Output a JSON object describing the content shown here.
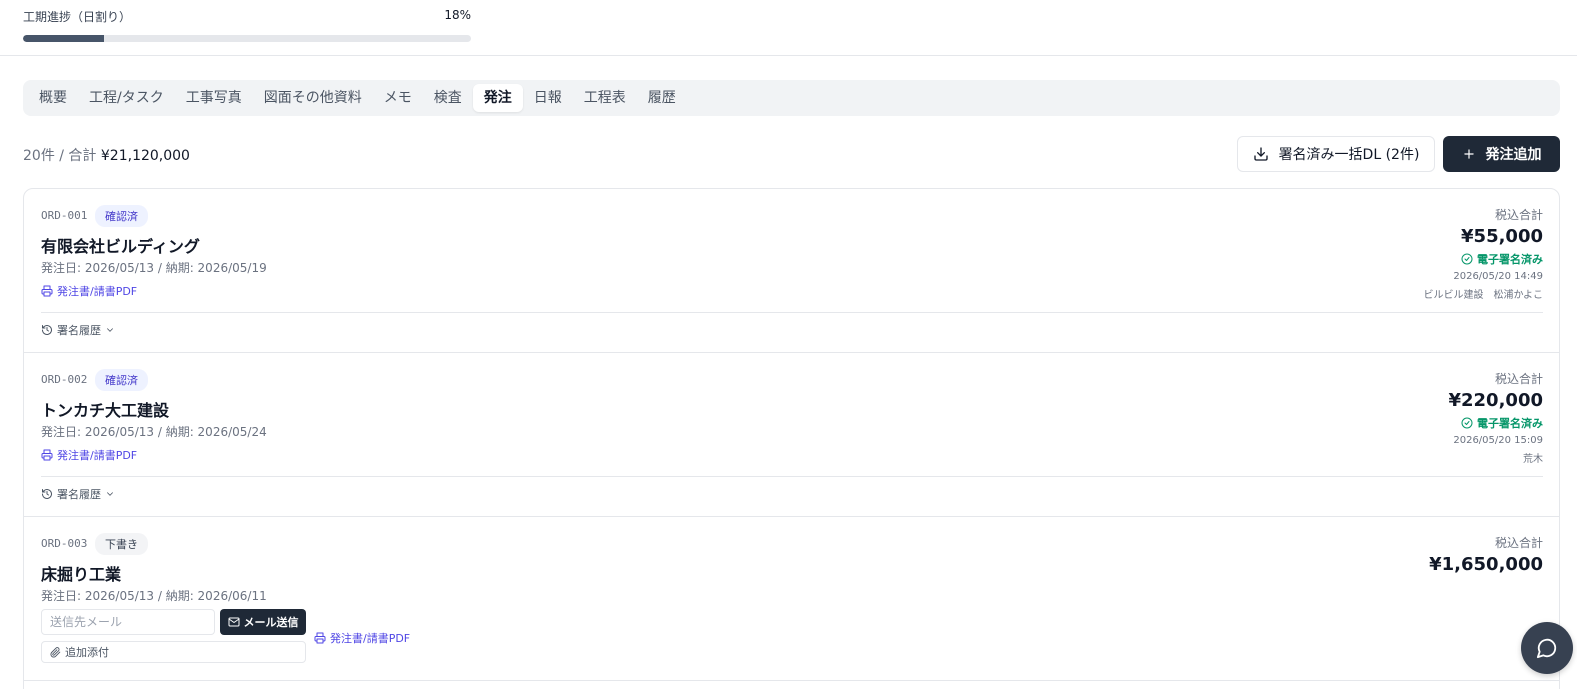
{
  "progress": {
    "label": "工期進捗（日割り）",
    "percent_text": "18%",
    "percent": 18
  },
  "tabs": [
    {
      "label": "概要"
    },
    {
      "label": "工程/タスク"
    },
    {
      "label": "工事写真"
    },
    {
      "label": "図面その他資料"
    },
    {
      "label": "メモ"
    },
    {
      "label": "検査"
    },
    {
      "label": "発注",
      "active": true
    },
    {
      "label": "日報"
    },
    {
      "label": "工程表"
    },
    {
      "label": "履歴"
    }
  ],
  "summary": {
    "count_text": "20件 / 合計 ",
    "total": "¥21,120,000"
  },
  "actions": {
    "download_label": "署名済み一括DL (2件)",
    "add_label": "発注追加"
  },
  "orders": [
    {
      "id": "ORD-001",
      "status": "確認済",
      "vendor": "有限会社ビルディング",
      "dates": "発注日: 2026/05/13 / 納期: 2026/05/19",
      "pdf_label": "発注書/請書PDF",
      "tax_label": "税込合計",
      "amount": "¥55,000",
      "signed_label": "電子署名済み",
      "signed_at": "2026/05/20 14:49",
      "signed_by": "ビルビル建設　松浦かよこ",
      "history_label": "署名履歴"
    },
    {
      "id": "ORD-002",
      "status": "確認済",
      "vendor": "トンカチ大工建設",
      "dates": "発注日: 2026/05/13 / 納期: 2026/05/24",
      "pdf_label": "発注書/請書PDF",
      "tax_label": "税込合計",
      "amount": "¥220,000",
      "signed_label": "電子署名済み",
      "signed_at": "2026/05/20 15:09",
      "signed_by": "荒木",
      "history_label": "署名履歴"
    },
    {
      "id": "ORD-003",
      "status": "下書き",
      "vendor": "床掘り工業",
      "dates": "発注日: 2026/05/13 / 納期: 2026/06/11",
      "email_placeholder": "送信先メール",
      "send_label": "メール送信",
      "attach_label": "追加添付",
      "pdf_label": "発注書/請書PDF",
      "tax_label": "税込合計",
      "amount": "¥1,650,000"
    }
  ],
  "colors": {
    "accent": "#4f46e5",
    "dark": "#1f2937",
    "signed_green": "#059669"
  }
}
